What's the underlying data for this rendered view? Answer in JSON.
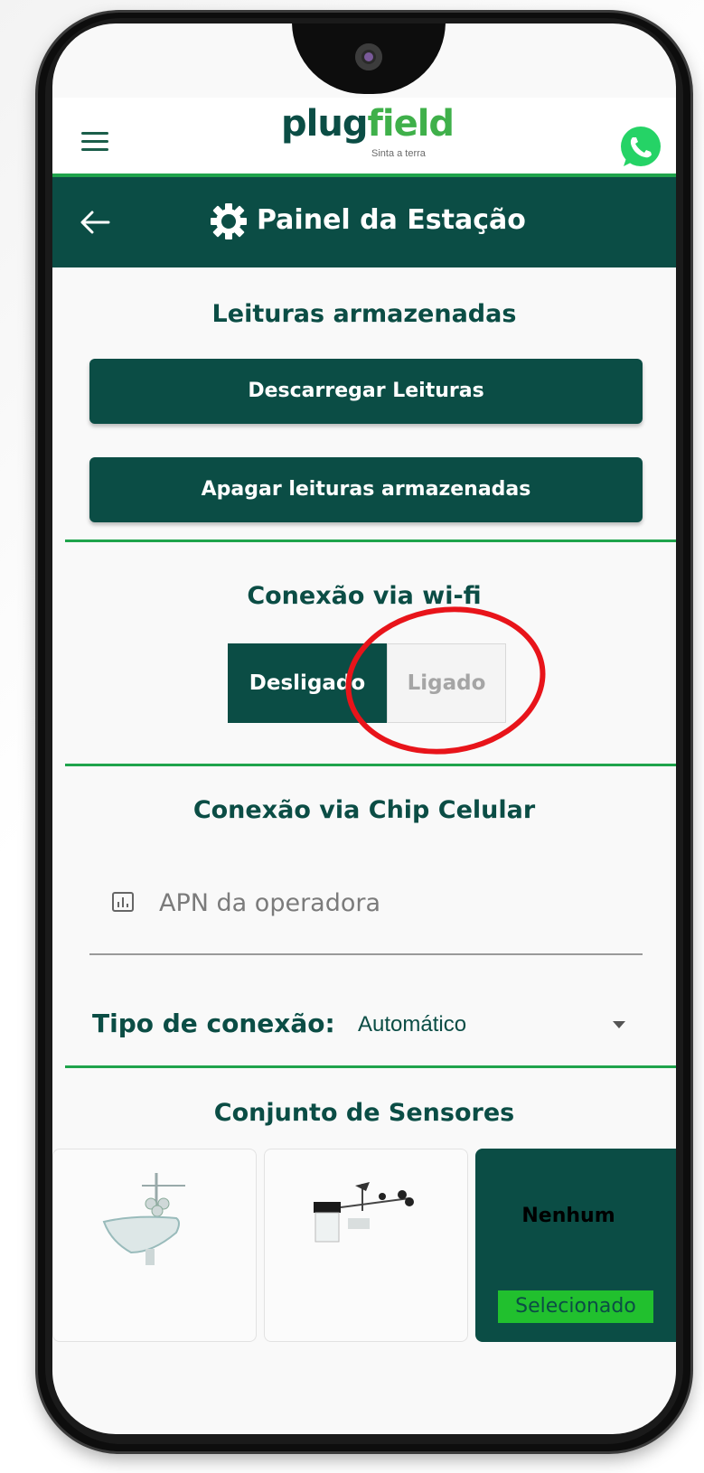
{
  "app": {
    "logo_plug": "plug",
    "logo_field": "field",
    "logo_tagline": "Sinta a terra",
    "header_title": "Painel da Estação"
  },
  "stored_readings": {
    "title": "Leituras armazenadas",
    "download_button": "Descarregar Leituras",
    "delete_button": "Apagar leituras armazenadas"
  },
  "wifi": {
    "title": "Conexão via wi-fi",
    "off_label": "Desligado",
    "on_label": "Ligado",
    "selected": "Desligado"
  },
  "cellular": {
    "title": "Conexão via Chip Celular",
    "apn_placeholder": "APN da operadora",
    "apn_value": "",
    "connection_type_label": "Tipo de conexão:",
    "connection_type_value": "Automático"
  },
  "sensors": {
    "title": "Conjunto de Sensores",
    "none_label": "Nenhum",
    "selected_badge": "Selecionado"
  },
  "colors": {
    "primary": "#0b4d45",
    "accent_green": "#1fa44c",
    "badge_green": "#21c02e",
    "annotation_red": "#e8141a",
    "whatsapp_green": "#25d366"
  },
  "icons": [
    "menu-icon",
    "whatsapp-icon",
    "back-arrow-icon",
    "gear-icon",
    "signal-chart-icon",
    "dropdown-arrow-icon",
    "weather-station-icon"
  ]
}
